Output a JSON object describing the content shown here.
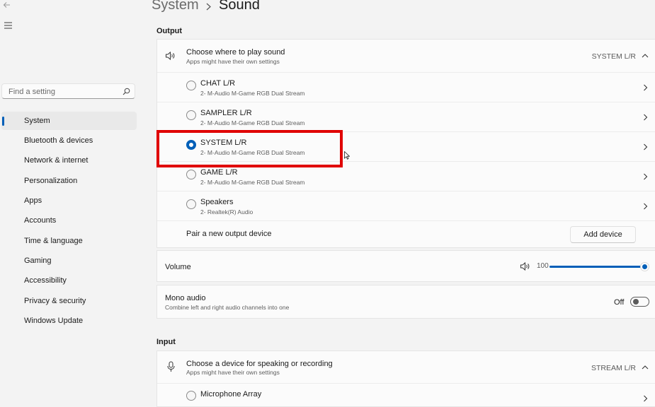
{
  "breadcrumb": {
    "parent": "System",
    "current": "Sound"
  },
  "search": {
    "placeholder": "Find a setting"
  },
  "nav": {
    "items": [
      {
        "label": "System",
        "active": true
      },
      {
        "label": "Bluetooth & devices"
      },
      {
        "label": "Network & internet"
      },
      {
        "label": "Personalization"
      },
      {
        "label": "Apps"
      },
      {
        "label": "Accounts"
      },
      {
        "label": "Time & language"
      },
      {
        "label": "Gaming"
      },
      {
        "label": "Accessibility"
      },
      {
        "label": "Privacy & security"
      },
      {
        "label": "Windows Update"
      }
    ]
  },
  "output": {
    "section_label": "Output",
    "header_title": "Choose where to play sound",
    "header_sub": "Apps might have their own settings",
    "selected_value": "SYSTEM L/R",
    "devices": [
      {
        "name": "CHAT L/R",
        "desc": "2- M-Audio M-Game RGB Dual Stream",
        "selected": false
      },
      {
        "name": "SAMPLER L/R",
        "desc": "2- M-Audio M-Game RGB Dual Stream",
        "selected": false
      },
      {
        "name": "SYSTEM L/R",
        "desc": "2- M-Audio M-Game RGB Dual Stream",
        "selected": true
      },
      {
        "name": "GAME L/R",
        "desc": "2- M-Audio M-Game RGB Dual Stream",
        "selected": false
      },
      {
        "name": "Speakers",
        "desc": "2- Realtek(R) Audio",
        "selected": false
      }
    ],
    "pair_label": "Pair a new output device",
    "add_device_label": "Add device"
  },
  "volume": {
    "label": "Volume",
    "value": "100",
    "level_percent": 100
  },
  "mono": {
    "title": "Mono audio",
    "sub": "Combine left and right audio channels into one",
    "state": "Off"
  },
  "input": {
    "section_label": "Input",
    "header_title": "Choose a device for speaking or recording",
    "header_sub": "Apps might have their own settings",
    "selected_value": "STREAM L/R",
    "devices": [
      {
        "name": "Microphone Array"
      }
    ]
  },
  "colors": {
    "accent": "#005fb8",
    "highlight": "#e00000"
  }
}
